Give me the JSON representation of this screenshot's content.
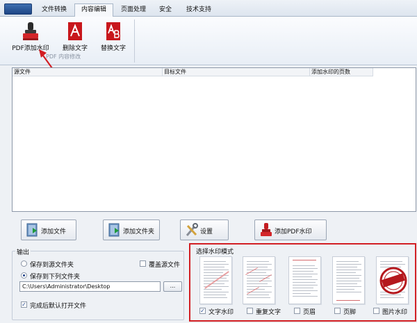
{
  "tabs": [
    "文件转换",
    "内容编辑",
    "页面处理",
    "安全",
    "技术支持"
  ],
  "ribbon": {
    "add_watermark": "PDF添加水印",
    "delete_text": "删除文字",
    "replace_text": "替换文字",
    "group_label": "PDF 内容修改"
  },
  "table": {
    "columns": [
      "源文件",
      "目标文件",
      "添加水印的页数"
    ]
  },
  "buttons": {
    "add_file": "添加文件",
    "add_folder": "添加文件夹",
    "settings": "设置",
    "add_pdf_watermark": "添加PDF水印"
  },
  "output": {
    "title": "输出",
    "save_source": "保存到源文件夹",
    "save_custom": "保存到下列文件夹",
    "overwrite": "覆盖源文件",
    "path": "C:\\Users\\Administrator\\Desktop",
    "browse": "...",
    "open_after": "完成后默认打开文件"
  },
  "watermark_mode": {
    "title": "选择水印模式",
    "options": [
      {
        "label": "文字水印",
        "checked": true
      },
      {
        "label": "重复文字",
        "checked": false
      },
      {
        "label": "页眉",
        "checked": false
      },
      {
        "label": "页脚",
        "checked": false
      },
      {
        "label": "图片水印",
        "checked": false
      }
    ],
    "stamp_text": "CERTIFIED ORIGINAL"
  },
  "colors": {
    "highlight": "#d21e23",
    "accent": "#1a3f88"
  }
}
